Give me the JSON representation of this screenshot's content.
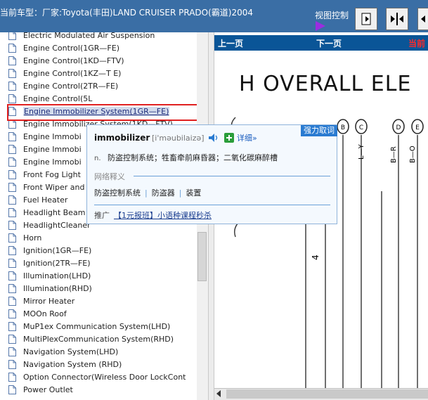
{
  "header": {
    "title": "当前车型：厂家:Toyota(丰田)LAND CRUISER PRADO(霸道)2004",
    "view_control_label": "视图控制"
  },
  "tree": {
    "items": [
      {
        "label": "Electric Modulated Air Suspension",
        "selected": false
      },
      {
        "label": "Engine Control(1GR—FE)",
        "selected": false
      },
      {
        "label": "Engine Control(1KD—FTV)",
        "selected": false
      },
      {
        "label": "Engine Control(1KZ—T E)",
        "selected": false
      },
      {
        "label": "Engine Control(2TR—FE)",
        "selected": false
      },
      {
        "label": "Engine Control(5L",
        "selected": false
      },
      {
        "label": "Engine Immobilizer System(1GR—FE)",
        "selected": true
      },
      {
        "label": "Engine Immobilizer System(1KD—FTV)",
        "selected": false
      },
      {
        "label": "Engine Immobi",
        "selected": false
      },
      {
        "label": "Engine Immobi",
        "selected": false
      },
      {
        "label": "Engine Immobi",
        "selected": false
      },
      {
        "label": "Front Fog Light",
        "selected": false
      },
      {
        "label": "Front Wiper and",
        "selected": false
      },
      {
        "label": "Fuel Heater",
        "selected": false
      },
      {
        "label": "Headlight Beam",
        "selected": false
      },
      {
        "label": "HeadlightCleaner",
        "selected": false
      },
      {
        "label": "Horn",
        "selected": false
      },
      {
        "label": "Ignition(1GR—FE)",
        "selected": false
      },
      {
        "label": "Ignition(2TR—FE)",
        "selected": false
      },
      {
        "label": "Illumination(LHD)",
        "selected": false
      },
      {
        "label": "Illumination(RHD)",
        "selected": false
      },
      {
        "label": "Mirror Heater",
        "selected": false
      },
      {
        "label": "MOOn Roof",
        "selected": false
      },
      {
        "label": "MuP1ex Communication System(LHD)",
        "selected": false
      },
      {
        "label": "MuItiPlexCommunication System(RHD)",
        "selected": false
      },
      {
        "label": "Navigation System(LHD)",
        "selected": false
      },
      {
        "label": "Navigation System (RHD)",
        "selected": false
      },
      {
        "label": "Option Connector(Wireless Door LockCont",
        "selected": false
      },
      {
        "label": "Power Outlet",
        "selected": false
      }
    ]
  },
  "pager": {
    "prev": "上一页",
    "next": "下一页",
    "current": "当前"
  },
  "document": {
    "heading": "H  OVERALL ELE",
    "connector_labels": [
      "B",
      "C",
      "D",
      "E"
    ],
    "wire_labels": [
      "L—Y",
      "B—R",
      "B—O"
    ],
    "side_number": "4"
  },
  "popup": {
    "tag": "强力取词",
    "word": "immobilizer",
    "phonetic": "[i'məubilaizə]",
    "detail_link": "详细»",
    "pos": "n.",
    "definition": "防盗控制系统；牲畜牵前麻昏器；二氧化碳麻醉槽",
    "net_heading": "网络释义",
    "net_items": [
      "防盗控制系统",
      "防盗器",
      "装置"
    ],
    "promo_label": "推广",
    "promo_link": "【1元报班】小语种课程秒杀"
  },
  "colors": {
    "topbar": "#3a6ea5",
    "navbar": "#0a5597",
    "selection_border": "#e02020",
    "popup_tag": "#2a7bd1"
  }
}
